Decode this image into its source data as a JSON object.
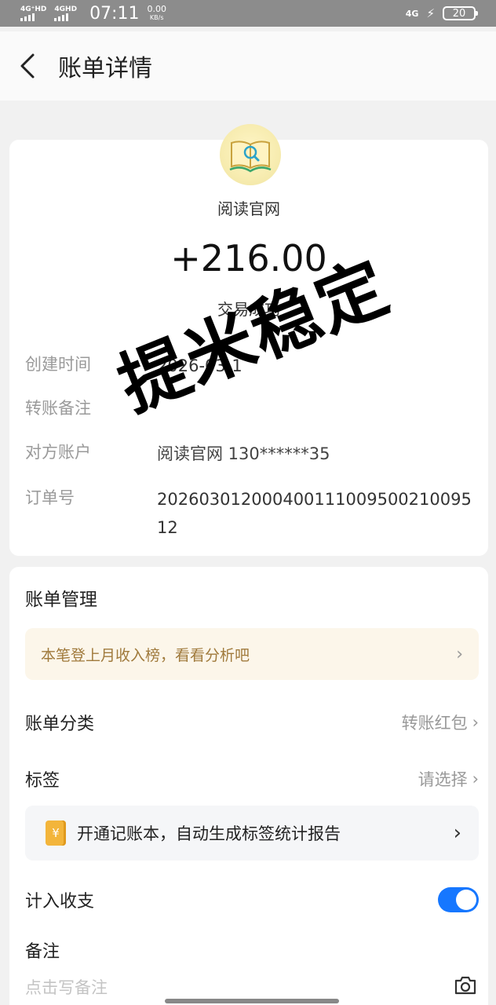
{
  "status_bar": {
    "sim1": "4G⁺HD",
    "sim2": "4GHD",
    "time": "07:11",
    "speed_value": "0.00",
    "speed_unit": "KB/s",
    "network_right": "4G",
    "battery": "20"
  },
  "header": {
    "title": "账单详情"
  },
  "transaction": {
    "merchant": "阅读官网",
    "amount": "+216.00",
    "status": "交易成功",
    "fields": [
      {
        "label": "创建时间",
        "value": "2026-03-1"
      },
      {
        "label": "转账备注",
        "value": ""
      },
      {
        "label": "对方账户",
        "value": "阅读官网 130******35"
      },
      {
        "label": "订单号",
        "value": "20260301200040011100950021009512"
      }
    ]
  },
  "overlay_stamp": "提米稳定",
  "manage": {
    "title": "账单管理",
    "promo": "本笔登上月收入榜，看看分析吧",
    "category_label": "账单分类",
    "category_value": "转账红包",
    "tag_label": "标签",
    "tag_value": "请选择",
    "notebook_text": "开通记账本，自动生成标签统计报告",
    "notebook_icon": "¥",
    "include_label": "计入收支",
    "include_enabled": true,
    "remark_label": "备注",
    "remark_placeholder": "点击写备注"
  },
  "icons": {
    "back": "chevron-left-icon",
    "chevron": "chevron-right-icon",
    "camera": "camera-icon",
    "logo": "book-search-icon"
  },
  "colors": {
    "accent": "#1677ff",
    "promo_text": "#a07a3c",
    "promo_bg": "#fcf6ea"
  }
}
